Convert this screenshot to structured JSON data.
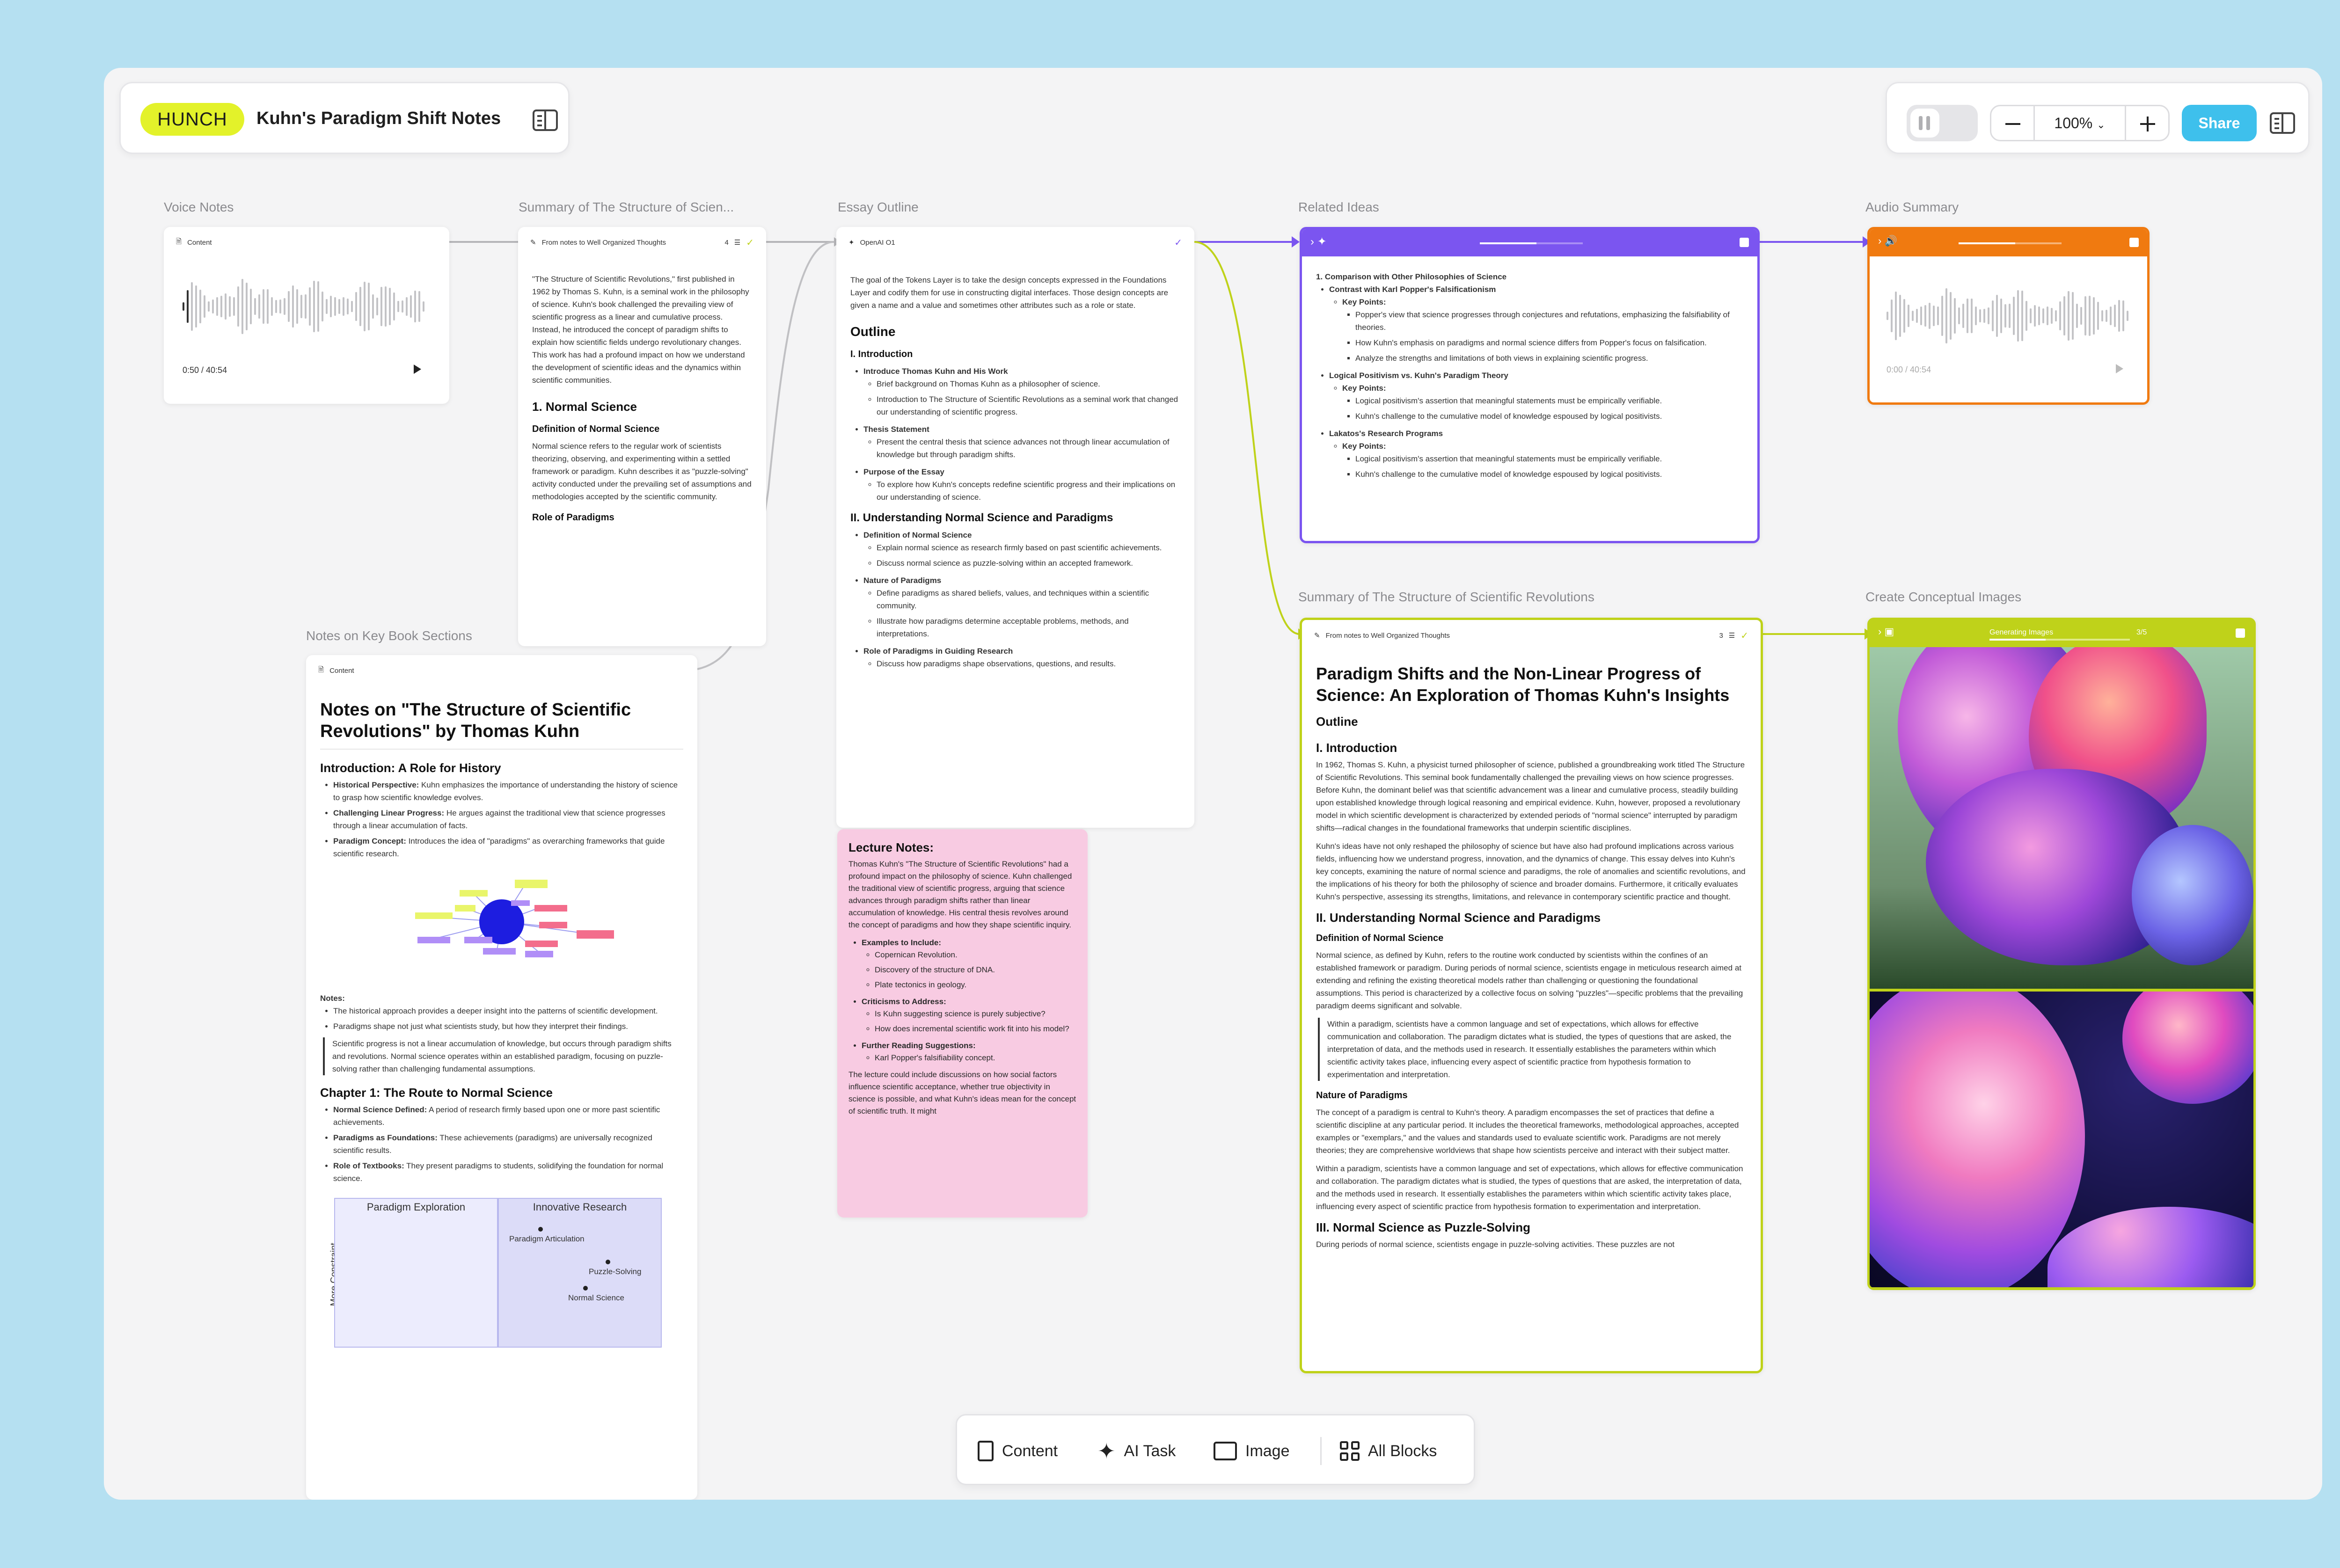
{
  "app": {
    "logo": "HUNCH",
    "doc_title": "Kuhn's Paradigm Shift Notes"
  },
  "toolbar": {
    "zoom": "100%",
    "share": "Share"
  },
  "labels": {
    "voice": "Voice Notes",
    "summary1": "Summary of The Structure of Scien...",
    "essay": "Essay Outline",
    "related": "Related Ideas",
    "audio": "Audio Summary",
    "notes": "Notes on Key Book Sections",
    "summary2": "Summary of The Structure of Scientific Revolutions",
    "images": "Create Conceptual Images"
  },
  "voice": {
    "tag": "Content",
    "time": "0:50 / 40:54"
  },
  "audio": {
    "time": "0:00 / 40:54"
  },
  "summary1": {
    "tag": "From notes to Well Organized Thoughts",
    "count": "4",
    "intro": "\"The Structure of Scientific Revolutions,\" first published in 1962 by Thomas S. Kuhn, is a seminal work in the philosophy of science. Kuhn's book challenged the prevailing view of scientific progress as a linear and cumulative process. Instead, he introduced the concept of paradigm shifts to explain how scientific fields undergo revolutionary changes. This work has had a profound impact on how we understand the development of scientific ideas and the dynamics within scientific communities.",
    "h1": "1. Normal Science",
    "h2": "Definition of Normal Science",
    "p2": "Normal science refers to the regular work of scientists theorizing, observing, and experimenting within a settled framework or paradigm. Kuhn describes it as \"puzzle-solving\" activity conducted under the prevailing set of assumptions and methodologies accepted by the scientific community.",
    "h3": "Role of Paradigms"
  },
  "essay": {
    "tag": "OpenAI O1",
    "intro": "The goal of the Tokens Layer is to take the design concepts expressed in the Foundations Layer and codify them for use in constructing digital interfaces. Those design concepts are given a name and a value and sometimes other attributes such as a role or state.",
    "outline": "Outline",
    "s1": "I. Introduction",
    "s1a": "Introduce Thomas Kuhn and His Work",
    "s1a1": "Brief background on Thomas Kuhn as a philosopher of science.",
    "s1a2": "Introduction to The Structure of Scientific Revolutions as a seminal work that changed our understanding of scientific progress.",
    "s1b": "Thesis Statement",
    "s1b1": "Present the central thesis that science advances not through linear accumulation of knowledge but through paradigm shifts.",
    "s1c": "Purpose of the Essay",
    "s1c1": "To explore how Kuhn's concepts redefine scientific progress and their implications on our understanding of science.",
    "s2": "II. Understanding Normal Science and Paradigms",
    "s2a": "Definition of Normal Science",
    "s2a1": "Explain normal science as research firmly based on past scientific achievements.",
    "s2a2": "Discuss normal science as puzzle-solving within an accepted framework.",
    "s2b": "Nature of Paradigms",
    "s2b1": "Define paradigms as shared beliefs, values, and techniques within a scientific community.",
    "s2b2": "Illustrate how paradigms determine acceptable problems, methods, and interpretations.",
    "s2c": "Role of Paradigms in Guiding Research",
    "s2c1": "Discuss how paradigms shape observations, questions, and results."
  },
  "related": {
    "h": "1. Comparison with Other Philosophies of Science",
    "a": "Contrast with Karl Popper's Falsificationism",
    "kp": "Key Points:",
    "a1": "Popper's view that science progresses through conjectures and refutations, emphasizing the falsifiability of theories.",
    "a2": "How Kuhn's emphasis on paradigms and normal science differs from Popper's focus on falsification.",
    "a3": "Analyze the strengths and limitations of both views in explaining scientific progress.",
    "b": "Logical Positivism vs. Kuhn's Paradigm Theory",
    "b1": "Logical positivism's assertion that meaningful statements must be empirically verifiable.",
    "b2": "Kuhn's challenge to the cumulative model of knowledge espoused by logical positivists.",
    "c": "Lakatos's Research Programs",
    "c1": "Logical positivism's assertion that meaningful statements must be empirically verifiable.",
    "c2": "Kuhn's challenge to the cumulative model of knowledge espoused by logical positivists."
  },
  "notes": {
    "tag": "Content",
    "title": "Notes on \"The Structure of Scientific Revolutions\" by Thomas Kuhn",
    "h1": "Introduction: A Role for History",
    "l1b": "Historical Perspective:",
    "l1": " Kuhn emphasizes the importance of understanding the history of science to grasp how scientific knowledge evolves.",
    "l2b": "Challenging Linear Progress:",
    "l2": " He argues against the traditional view that science progresses through a linear accumulation of facts.",
    "l3b": "Paradigm Concept:",
    "l3": " Introduces the idea of \"paradigms\" as overarching frameworks that guide scientific research.",
    "notes_h": "Notes:",
    "n1": "The historical approach provides a deeper insight into the patterns of scientific development.",
    "n2": "Paradigms shape not just what scientists study, but how they interpret their findings.",
    "quote": "Scientific progress is not a linear accumulation of knowledge, but occurs through paradigm shifts and revolutions. Normal science operates within an established paradigm, focusing on puzzle-solving rather than challenging fundamental assumptions.",
    "h2": "Chapter 1: The Route to Normal Science",
    "m1b": "Normal Science Defined:",
    "m1": " A period of research firmly based upon one or more past scientific achievements.",
    "m2b": "Paradigms as Foundations:",
    "m2": " These achievements (paradigms) are universally recognized scientific results.",
    "m3b": "Role of Textbooks:",
    "m3": " They present paradigms to students, solidifying the foundation for normal science.",
    "chart_q1": "Paradigm Exploration",
    "chart_q2": "Innovative Research",
    "chart_ylabel": "More Constraint",
    "chart_p1": "Paradigm Articulation",
    "chart_p2": "Puzzle-Solving",
    "chart_p3": "Normal Science"
  },
  "lecture": {
    "title": "Lecture Notes:",
    "intro": "Thomas Kuhn's \"The Structure of Scientific Revolutions\" had a profound impact on the philosophy of science. Kuhn challenged the traditional view of scientific progress, arguing that science advances through paradigm shifts rather than linear accumulation of knowledge. His central thesis revolves around the concept of paradigms and how they shape scientific inquiry.",
    "ex": "Examples to Include:",
    "ex1": "Copernican Revolution.",
    "ex2": "Discovery of the structure of DNA.",
    "ex3": "Plate tectonics in geology.",
    "cr": "Criticisms to Address:",
    "cr1": "Is Kuhn suggesting science is purely subjective?",
    "cr2": "How does incremental scientific work fit into his model?",
    "fr": "Further Reading Suggestions:",
    "fr1": "Karl Popper's falsifiability concept.",
    "outro": "The lecture could include discussions on how social factors influence scientific acceptance, whether true objectivity in science is possible, and what Kuhn's ideas mean for the concept of scientific truth. It might"
  },
  "summary2": {
    "tag": "From notes to Well Organized Thoughts",
    "count": "3",
    "title": "Paradigm Shifts and the Non-Linear Progress of Science: An Exploration of Thomas Kuhn's Insights",
    "outline": "Outline",
    "h1": "I. Introduction",
    "p1": "In 1962, Thomas S. Kuhn, a physicist turned philosopher of science, published a groundbreaking work titled The Structure of Scientific Revolutions. This seminal book fundamentally challenged the prevailing views on how science progresses. Before Kuhn, the dominant belief was that scientific advancement was a linear and cumulative process, steadily building upon established knowledge through logical reasoning and empirical evidence. Kuhn, however, proposed a revolutionary model in which scientific development is characterized by extended periods of \"normal science\" interrupted by paradigm shifts—radical changes in the foundational frameworks that underpin scientific disciplines.",
    "p2": "Kuhn's ideas have not only reshaped the philosophy of science but have also had profound implications across various fields, influencing how we understand progress, innovation, and the dynamics of change. This essay delves into Kuhn's key concepts, examining the nature of normal science and paradigms, the role of anomalies and scientific revolutions, and the implications of his theory for both the philosophy of science and broader domains. Furthermore, it critically evaluates Kuhn's perspective, assessing its strengths, limitations, and relevance in contemporary scientific practice and thought.",
    "h2": "II. Understanding Normal Science and Paradigms",
    "h2a": "Definition of Normal Science",
    "p3": "Normal science, as defined by Kuhn, refers to the routine work conducted by scientists within the confines of an established framework or paradigm. During periods of normal science, scientists engage in meticulous research aimed at extending and refining the existing theoretical models rather than challenging or questioning the foundational assumptions. This period is characterized by a collective focus on solving \"puzzles\"—specific problems that the prevailing paradigm deems significant and solvable.",
    "quote": "Within a paradigm, scientists have a common language and set of expectations, which allows for effective communication and collaboration. The paradigm dictates what is studied, the types of questions that are asked, the interpretation of data, and the methods used in research. It essentially establishes the parameters within which scientific activity takes place, influencing every aspect of scientific practice from hypothesis formation to experimentation and interpretation.",
    "h2b": "Nature of Paradigms",
    "p4": "The concept of a paradigm is central to Kuhn's theory. A paradigm encompasses the set of practices that define a scientific discipline at any particular period. It includes the theoretical frameworks, methodological approaches, accepted examples or \"exemplars,\" and the values and standards used to evaluate scientific work. Paradigms are not merely theories; they are comprehensive worldviews that shape how scientists perceive and interact with their subject matter.",
    "p5": "Within a paradigm, scientists have a common language and set of expectations, which allows for effective communication and collaboration. The paradigm dictates what is studied, the types of questions that are asked, the interpretation of data, and the methods used in research. It essentially establishes the parameters within which scientific activity takes place, influencing every aspect of scientific practice from hypothesis formation to experimentation and interpretation.",
    "h3": "III. Normal Science as Puzzle-Solving",
    "p6": "During periods of normal science, scientists engage in puzzle-solving activities. These puzzles are not"
  },
  "images": {
    "status": "Generating Images",
    "count": "3/5"
  },
  "dock": {
    "content": "Content",
    "ai": "AI Task",
    "image": "Image",
    "all": "All Blocks"
  },
  "colors": {
    "accent_purple": "#7b55f0",
    "accent_orange": "#f07a10",
    "accent_lime": "#bfd21a",
    "share_blue": "#3ec0ec",
    "lecture_pink": "#f8cbe2",
    "logo_yellow": "#e3f22a"
  }
}
